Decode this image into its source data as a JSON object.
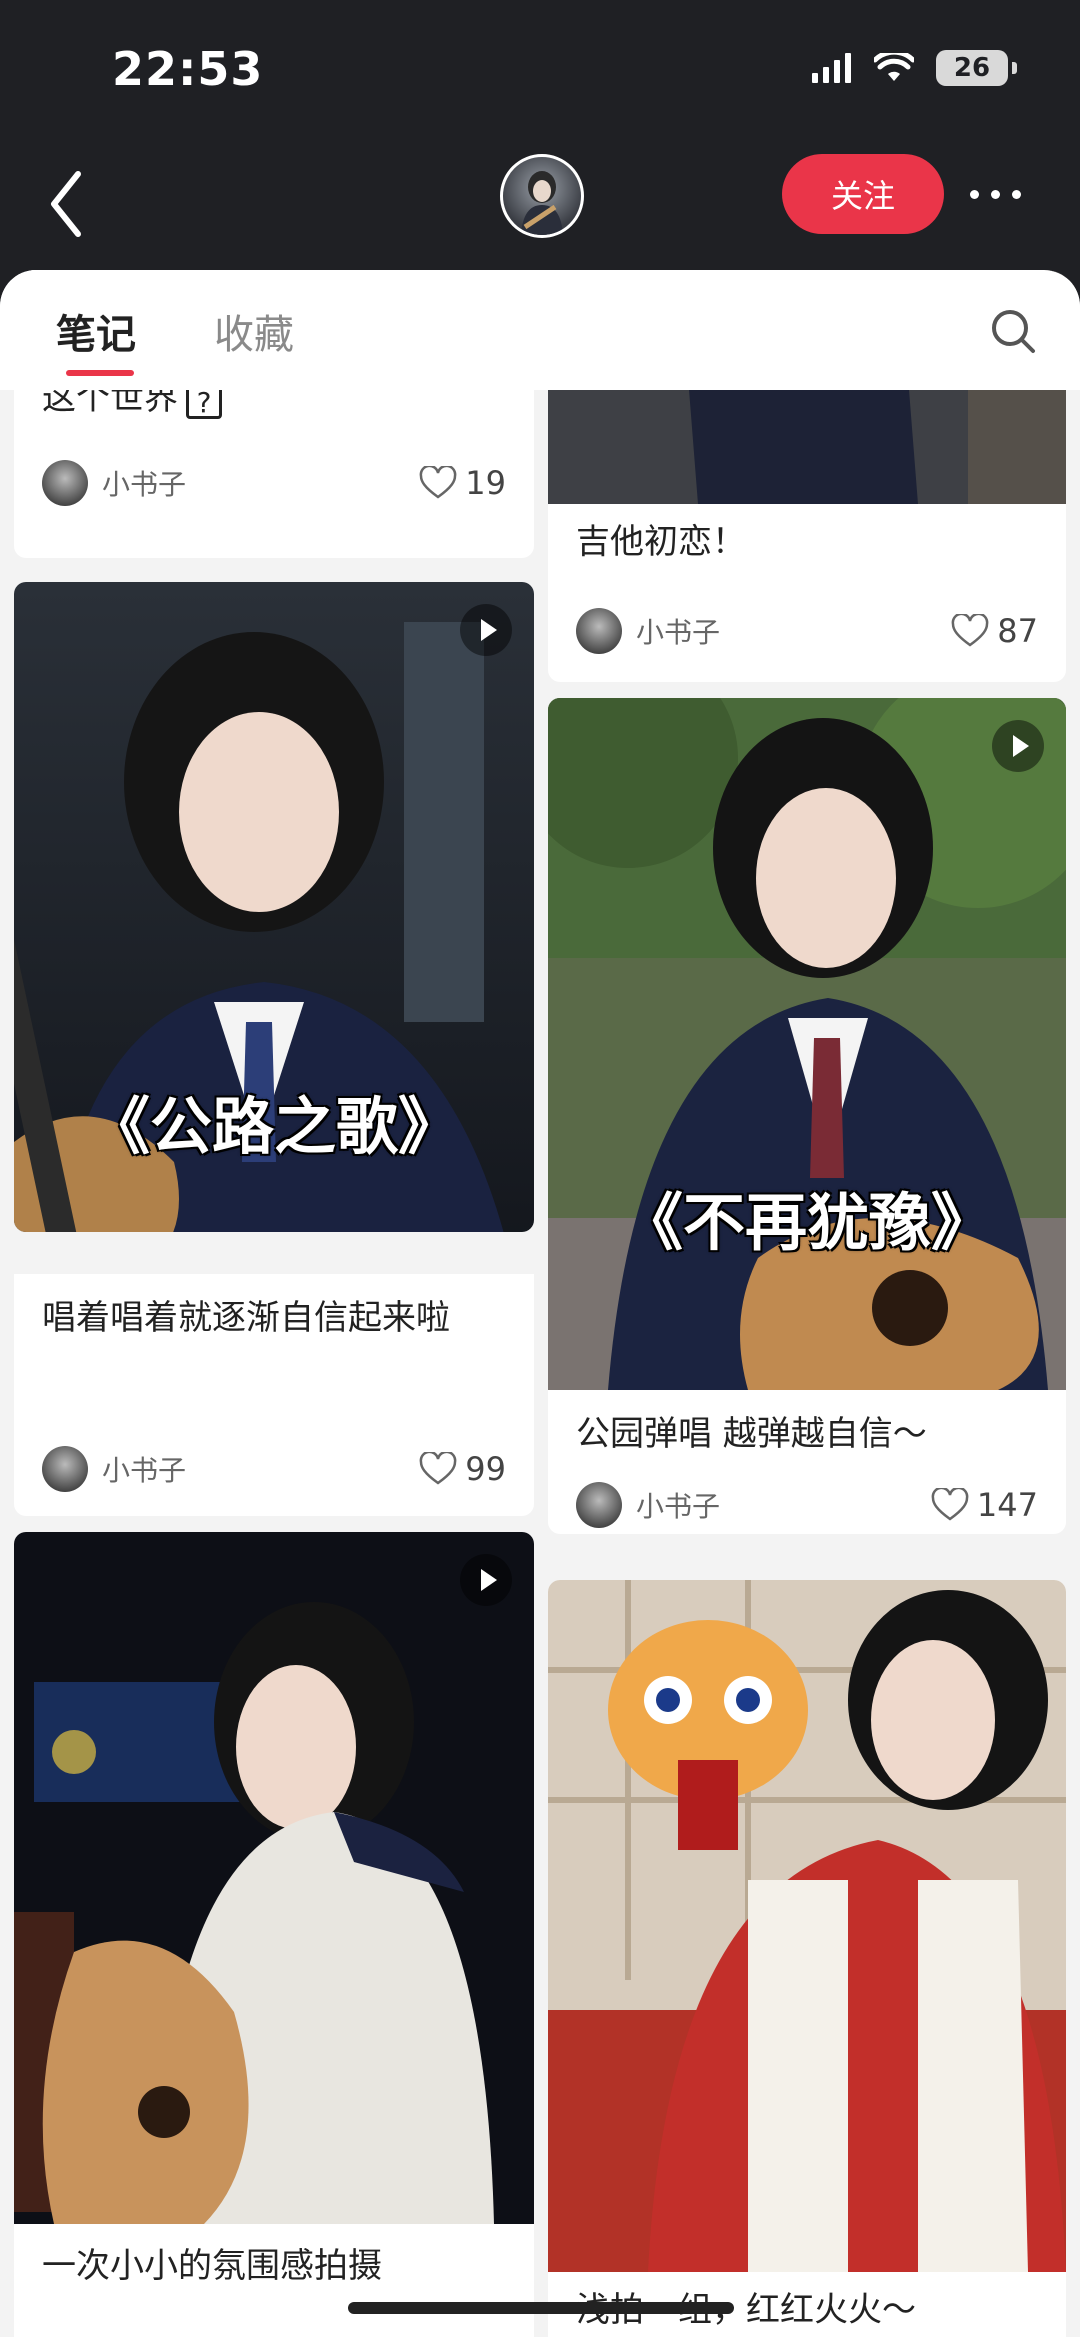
{
  "status_bar": {
    "time": "22:53",
    "battery": "26"
  },
  "header": {
    "follow_label": "关注"
  },
  "tabs": [
    {
      "label": "笔记"
    },
    {
      "label": "收藏"
    }
  ],
  "cards": [
    {
      "title": "这个世界",
      "author": "小书子",
      "likes": "19"
    },
    {
      "title": "吉他初恋！",
      "author": "小书子",
      "likes": "87"
    },
    {
      "overlay": "《公路之歌》",
      "title": "唱着唱着就逐渐自信起来啦",
      "author": "小书子",
      "likes": "99"
    },
    {
      "overlay": "《不再犹豫》",
      "title": "公园弹唱 越弹越自信～",
      "author": "小书子",
      "likes": "147"
    },
    {
      "title": "一次小小的氛围感拍摄"
    },
    {
      "title": "浅拍一组，红红火火～"
    }
  ],
  "icons": {
    "back": "chevron-left-icon",
    "more": "ellipsis-icon",
    "search": "search-icon",
    "play": "play-icon",
    "like": "heart-icon"
  },
  "colors": {
    "accent": "#ea3549",
    "header_bg": "#1f2024",
    "page_bg": "#f3f3f3"
  }
}
